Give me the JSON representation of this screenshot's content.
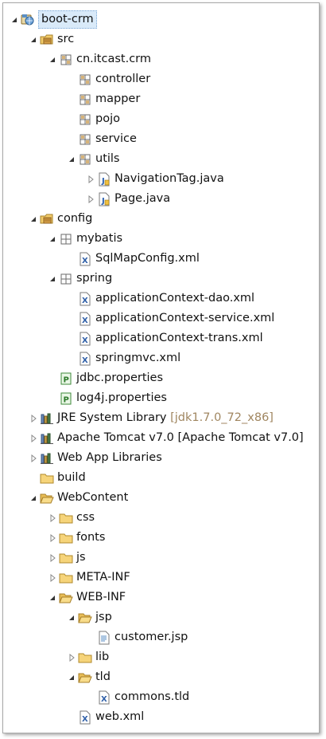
{
  "tree": [
    {
      "label": "boot-crm",
      "depth": 0,
      "twisty": "expanded",
      "icon": "web-project-icon",
      "selected": true
    },
    {
      "label": "src",
      "depth": 1,
      "twisty": "expanded",
      "icon": "source-folder-icon"
    },
    {
      "label": "cn.itcast.crm",
      "depth": 2,
      "twisty": "expanded",
      "icon": "package-icon"
    },
    {
      "label": "controller",
      "depth": 3,
      "twisty": "none",
      "icon": "package-icon"
    },
    {
      "label": "mapper",
      "depth": 3,
      "twisty": "none",
      "icon": "package-icon"
    },
    {
      "label": "pojo",
      "depth": 3,
      "twisty": "none",
      "icon": "package-icon"
    },
    {
      "label": "service",
      "depth": 3,
      "twisty": "none",
      "icon": "package-icon"
    },
    {
      "label": "utils",
      "depth": 3,
      "twisty": "expanded",
      "icon": "package-icon"
    },
    {
      "label": "NavigationTag.java",
      "depth": 4,
      "twisty": "collapsed",
      "icon": "java-file-icon"
    },
    {
      "label": "Page.java",
      "depth": 4,
      "twisty": "collapsed",
      "icon": "java-file-icon"
    },
    {
      "label": "config",
      "depth": 1,
      "twisty": "expanded",
      "icon": "source-folder-icon"
    },
    {
      "label": "mybatis",
      "depth": 2,
      "twisty": "expanded",
      "icon": "empty-package-icon"
    },
    {
      "label": "SqlMapConfig.xml",
      "depth": 3,
      "twisty": "none",
      "icon": "xml-file-icon"
    },
    {
      "label": "spring",
      "depth": 2,
      "twisty": "expanded",
      "icon": "empty-package-icon"
    },
    {
      "label": "applicationContext-dao.xml",
      "depth": 3,
      "twisty": "none",
      "icon": "xml-file-icon"
    },
    {
      "label": "applicationContext-service.xml",
      "depth": 3,
      "twisty": "none",
      "icon": "xml-file-icon"
    },
    {
      "label": "applicationContext-trans.xml",
      "depth": 3,
      "twisty": "none",
      "icon": "xml-file-icon"
    },
    {
      "label": "springmvc.xml",
      "depth": 3,
      "twisty": "none",
      "icon": "xml-file-icon"
    },
    {
      "label": "jdbc.properties",
      "depth": 2,
      "twisty": "none",
      "icon": "properties-file-icon"
    },
    {
      "label": "log4j.properties",
      "depth": 2,
      "twisty": "none",
      "icon": "properties-file-icon"
    },
    {
      "label": "JRE System Library",
      "decoration": "[jdk1.7.0_72_x86]",
      "depth": 1,
      "twisty": "collapsed",
      "icon": "library-icon"
    },
    {
      "label": "Apache Tomcat v7.0 [Apache Tomcat v7.0]",
      "depth": 1,
      "twisty": "collapsed",
      "icon": "library-icon"
    },
    {
      "label": "Web App Libraries",
      "depth": 1,
      "twisty": "collapsed",
      "icon": "library-icon"
    },
    {
      "label": "build",
      "depth": 1,
      "twisty": "none",
      "icon": "folder-icon"
    },
    {
      "label": "WebContent",
      "depth": 1,
      "twisty": "expanded",
      "icon": "open-folder-icon"
    },
    {
      "label": "css",
      "depth": 2,
      "twisty": "collapsed",
      "icon": "folder-icon"
    },
    {
      "label": "fonts",
      "depth": 2,
      "twisty": "collapsed",
      "icon": "folder-icon"
    },
    {
      "label": "js",
      "depth": 2,
      "twisty": "collapsed",
      "icon": "folder-icon"
    },
    {
      "label": "META-INF",
      "depth": 2,
      "twisty": "collapsed",
      "icon": "folder-icon"
    },
    {
      "label": "WEB-INF",
      "depth": 2,
      "twisty": "expanded",
      "icon": "open-folder-icon"
    },
    {
      "label": "jsp",
      "depth": 3,
      "twisty": "expanded",
      "icon": "open-folder-icon"
    },
    {
      "label": "customer.jsp",
      "depth": 4,
      "twisty": "none",
      "icon": "jsp-file-icon"
    },
    {
      "label": "lib",
      "depth": 3,
      "twisty": "collapsed",
      "icon": "folder-icon"
    },
    {
      "label": "tld",
      "depth": 3,
      "twisty": "expanded",
      "icon": "open-folder-icon"
    },
    {
      "label": "commons.tld",
      "depth": 4,
      "twisty": "none",
      "icon": "xml-file-icon"
    },
    {
      "label": "web.xml",
      "depth": 3,
      "twisty": "none",
      "icon": "xml-file-icon"
    }
  ]
}
